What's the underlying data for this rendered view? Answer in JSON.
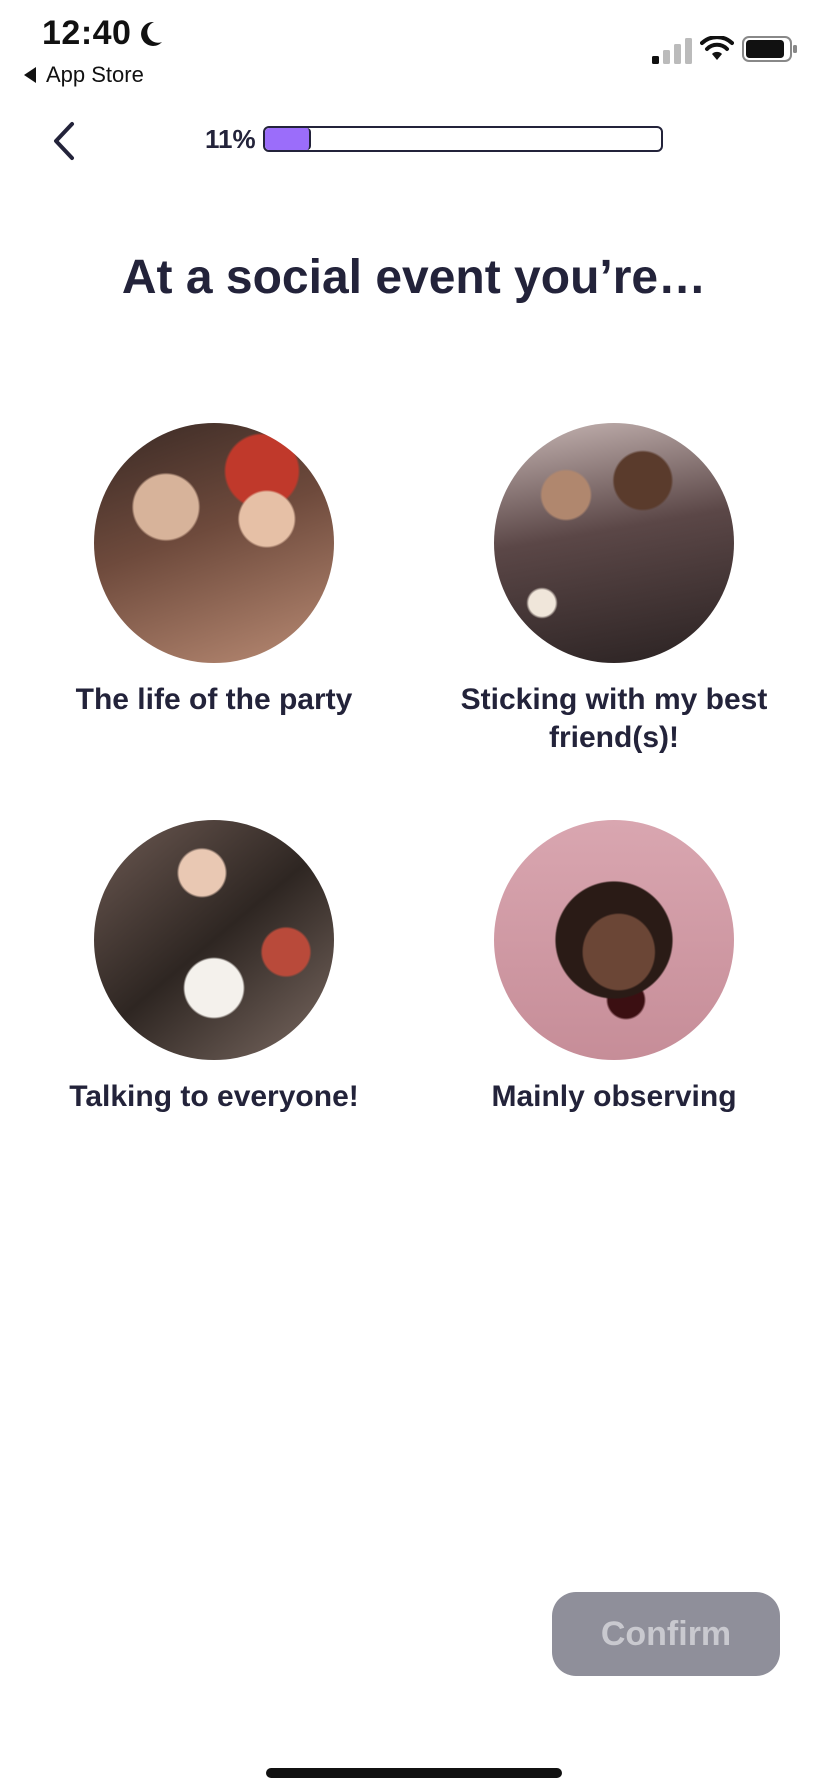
{
  "status_bar": {
    "time": "12:40",
    "back_app_label": "App Store",
    "icons": [
      "moon-icon",
      "cellular-signal-icon",
      "wifi-icon",
      "battery-icon"
    ]
  },
  "header": {
    "back_icon": "chevron-left-icon",
    "progress_text": "11%",
    "progress_value": 0.11,
    "progress_color": "#9b6dfa"
  },
  "question": {
    "title": "At a social event you’re…"
  },
  "options": [
    {
      "label": "The life of the party"
    },
    {
      "label": "Sticking with my best friend(s)!"
    },
    {
      "label": "Talking to everyone!"
    },
    {
      "label": "Mainly observing"
    }
  ],
  "footer": {
    "confirm_label": "Confirm",
    "confirm_color": "#8f8f9a"
  }
}
